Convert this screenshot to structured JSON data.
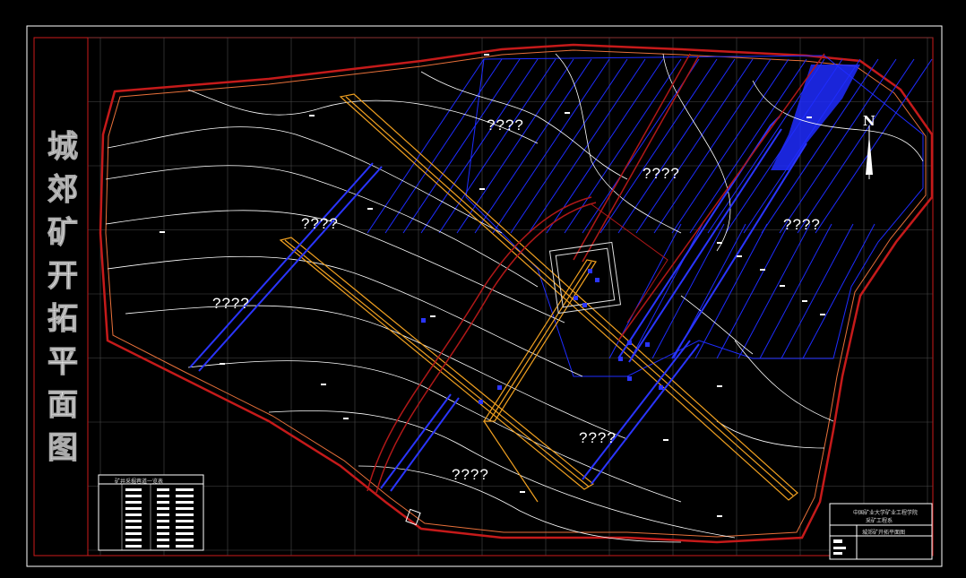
{
  "title_vertical": [
    "城",
    "郊",
    "矿",
    "开",
    "拓",
    "平",
    "面",
    "图"
  ],
  "zones": [
    "????",
    "????",
    "????",
    "????",
    "????",
    "????",
    "????"
  ],
  "north_label": "N",
  "title_block": {
    "line1": "中国矿业大学矿业工程学院",
    "line2": "采矿工程系",
    "drawing_name": "城郊矿开拓平面图"
  },
  "legend_table": {
    "header": "矿井采掘巷道一览表"
  },
  "colors": {
    "background": "#000000",
    "frame": "#ffffff",
    "boundary": "#cc1a1a",
    "roadway": "#f0a020",
    "panels": "#1e2cff",
    "contour": "#ffffff",
    "grid": "#4a4a4a"
  }
}
